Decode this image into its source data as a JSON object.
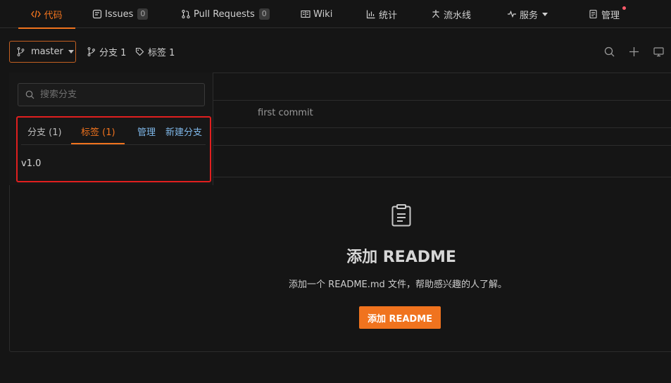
{
  "nav": {
    "code": "代码",
    "issues": "Issues",
    "issues_count": "0",
    "pull_requests": "Pull Requests",
    "pr_count": "0",
    "wiki": "Wiki",
    "stats": "统计",
    "pipeline": "流水线",
    "services": "服务",
    "manage": "管理"
  },
  "repo_bar": {
    "branch": "master",
    "branches": "分支 1",
    "tags": "标签 1"
  },
  "dropdown": {
    "search_placeholder": "搜索分支",
    "tab_branches": "分支 (1)",
    "tab_tags": "标签 (1)",
    "manage_link": "管理",
    "new_branch_link": "新建分支",
    "tags": [
      "v1.0"
    ]
  },
  "file_list": {
    "commit_message": "first commit"
  },
  "empty_state": {
    "title": "添加 README",
    "description": "添加一个 README.md 文件，帮助感兴趣的人了解。",
    "button": "添加 README"
  },
  "colors": {
    "accent": "#f0731e",
    "highlight": "#e01f1f",
    "link": "#7fb7e8",
    "background": "#151515"
  }
}
